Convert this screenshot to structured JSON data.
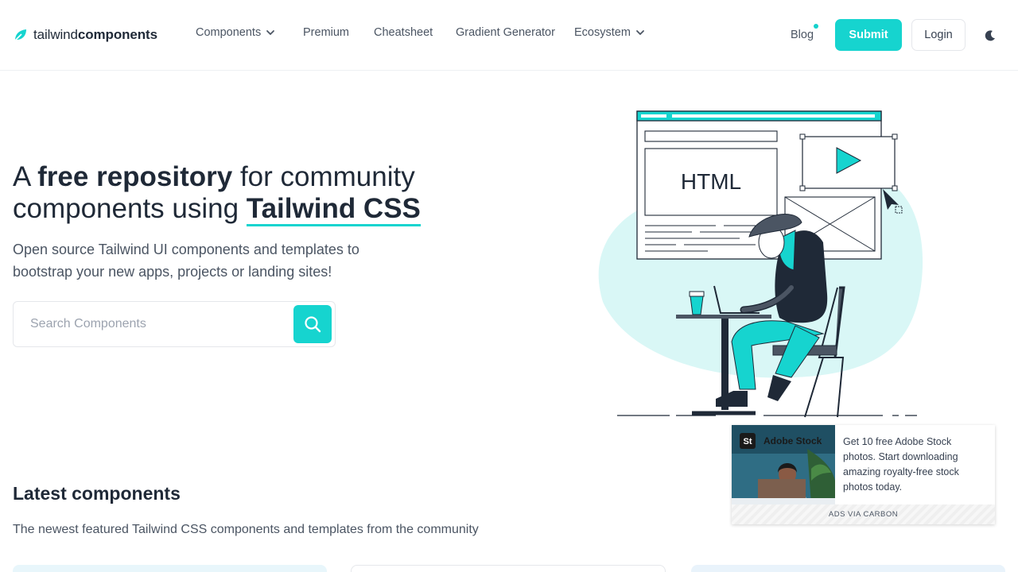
{
  "header": {
    "logo_light": "tailwind",
    "logo_bold": "components",
    "nav": [
      {
        "label": "Components",
        "has_dropdown": true
      },
      {
        "label": "Premium",
        "has_dropdown": false
      },
      {
        "label": "Cheatsheet",
        "has_dropdown": false
      },
      {
        "label": "Gradient Generator",
        "has_dropdown": false
      },
      {
        "label": "Ecosystem",
        "has_dropdown": true
      }
    ],
    "blog_label": "Blog",
    "submit_label": "Submit",
    "login_label": "Login"
  },
  "hero": {
    "title_part1": "A ",
    "title_bold": "free repository",
    "title_part2": " for community components using ",
    "title_brand": "Tailwind CSS",
    "subtitle": "Open source Tailwind UI components and templates to bootstrap your new apps, projects or landing sites!",
    "search_placeholder": "Search Components",
    "illustration_label": "HTML"
  },
  "latest": {
    "title": "Latest components",
    "subtitle": "The newest featured Tailwind CSS components and templates from the community"
  },
  "ad": {
    "brand_badge": "St",
    "brand_name": "Adobe Stock",
    "text": "Get 10 free Adobe Stock photos. Start downloading amazing royalty-free stock photos today.",
    "footer": "ADS VIA CARBON"
  },
  "colors": {
    "accent": "#16d4cf",
    "text_dark": "#1f2937",
    "text_muted": "#4b5563",
    "illustration_bg": "#d9f7f6"
  }
}
